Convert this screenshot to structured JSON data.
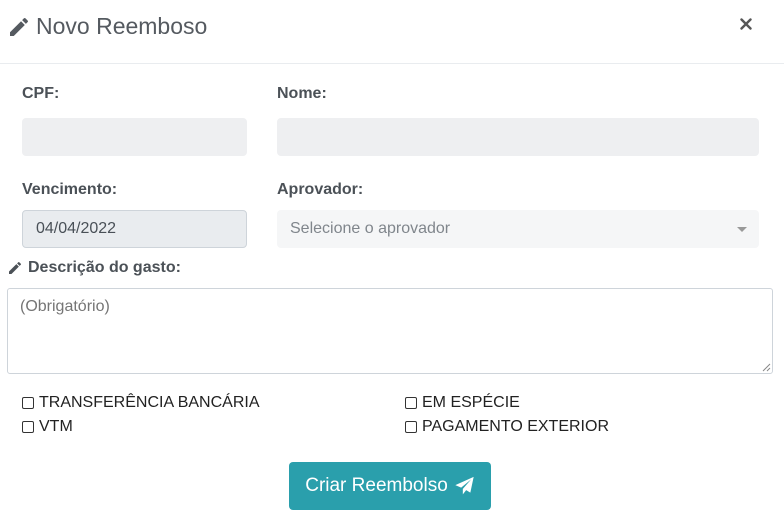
{
  "header": {
    "title": "Novo Reemboso",
    "close_label": "×"
  },
  "form": {
    "cpf_label": "CPF:",
    "nome_label": "Nome:",
    "vencimento_label": "Vencimento:",
    "vencimento_value": "04/04/2022",
    "aprovador_label": "Aprovador:",
    "aprovador_placeholder": "Selecione o aprovador",
    "descricao_label": "Descrição do gasto:",
    "descricao_placeholder": "(Obrigatório)"
  },
  "payment_options": [
    {
      "label": "TRANSFERÊNCIA BANCÁRIA",
      "checked": false
    },
    {
      "label": "EM ESPÉCIE",
      "checked": false
    },
    {
      "label": "VTM",
      "checked": false
    },
    {
      "label": "PAGAMENTO EXTERIOR",
      "checked": false
    }
  ],
  "submit": {
    "label": "Criar Reembolso"
  },
  "colors": {
    "primary": "#2a9fac",
    "title": "#555a60",
    "label": "#4b5157"
  },
  "icons": {
    "title_icon": "pencil-icon",
    "submit_icon": "paper-plane-icon",
    "close_icon": "close-icon"
  }
}
